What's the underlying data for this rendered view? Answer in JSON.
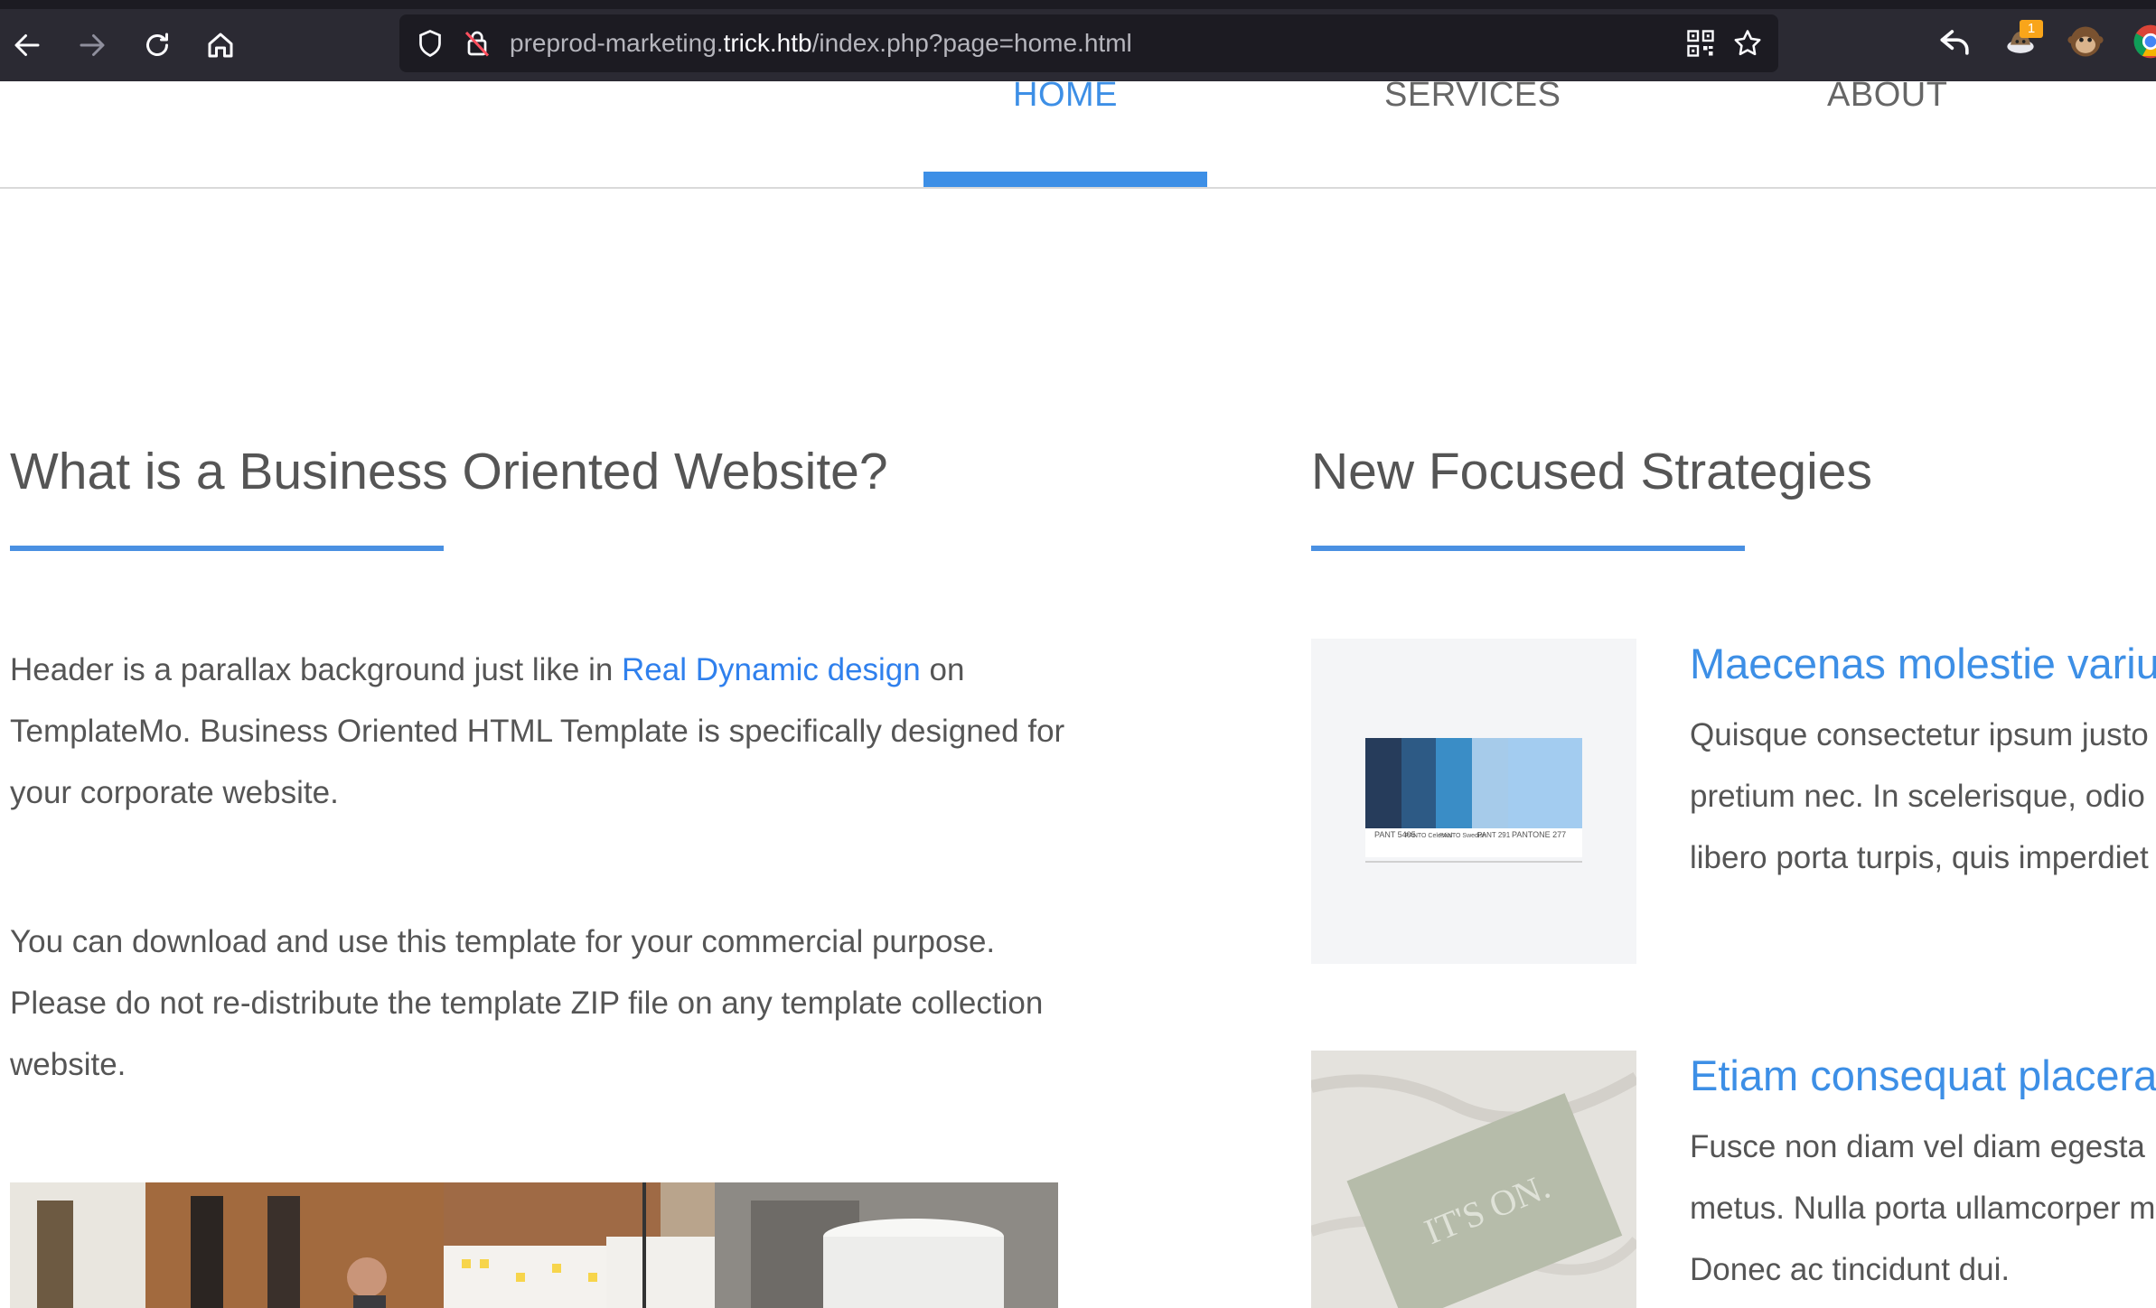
{
  "browser": {
    "url_prefix": "preprod-marketing.",
    "url_host": "trick.htb",
    "url_path": "/index.php?page=home.html",
    "extension_badge": "1"
  },
  "nav": {
    "items": [
      {
        "label": "HOME",
        "active": true
      },
      {
        "label": "SERVICES",
        "active": false
      },
      {
        "label": "ABOUT",
        "active": false
      }
    ]
  },
  "left": {
    "heading": "What is a Business Oriented Website?",
    "p1_before": "Header is a parallax background just like in ",
    "p1_link": "Real Dynamic design",
    "p1_after": " on TemplateMo. Business Oriented HTML Template is specifically designed for your corporate website.",
    "p2": "You can download and use this template for your commercial purpose. Please do not re-distribute the template ZIP file on any template collection website."
  },
  "right": {
    "heading": "New Focused Strategies",
    "cards": [
      {
        "title": "Maecenas molestie variu",
        "text": "Quisque consectetur ipsum justo\npretium nec. In scelerisque, odio\nlibero porta turpis, quis imperdiet",
        "swatch_labels": [
          "PANT 5405",
          "PANTO Celestial",
          "PANTO Swedish",
          "PANT 291",
          "PANTONE 277"
        ]
      },
      {
        "title": "Etiam consequat placera",
        "text": "Fusce non diam vel diam egesta\nmetus. Nulla porta ullamcorper m\nDonec ac tincidunt dui.",
        "card_text": "IT'S ON."
      }
    ]
  },
  "colors": {
    "accent": "#3d8fe6",
    "chrome_bg": "#2b2a33",
    "urlbar_bg": "#1c1b22"
  }
}
